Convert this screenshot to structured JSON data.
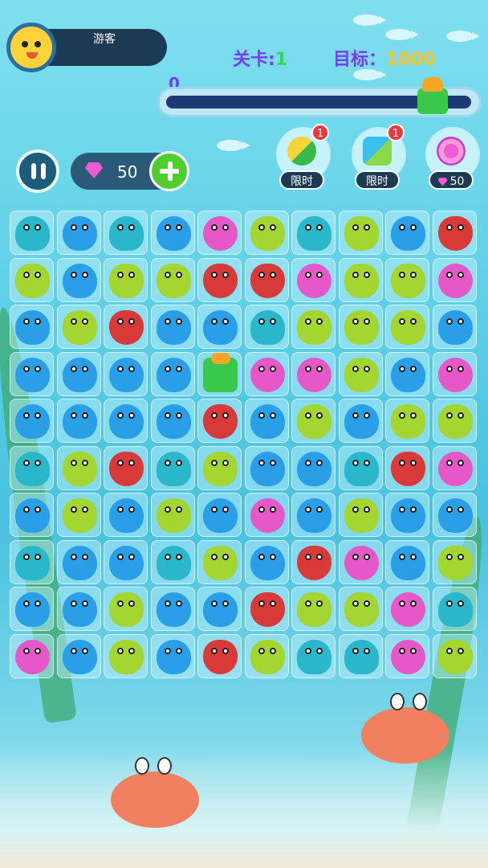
{
  "player": {
    "name": "游客"
  },
  "level": {
    "label": "关卡",
    "value": "1"
  },
  "target": {
    "label": "目标",
    "value": "1000"
  },
  "progress": {
    "score": "0",
    "fraction": 0
  },
  "gems": {
    "count": "50"
  },
  "tools": [
    {
      "name": "限时",
      "badge": "1",
      "icon": "refresh-hammer-icon"
    },
    {
      "name": "限时",
      "badge": "1",
      "icon": "water-gun-icon"
    },
    {
      "name": "50",
      "icon": "lollipop-icon"
    }
  ],
  "board": {
    "rows": [
      [
        "penguin",
        "whale",
        "penguin",
        "whale",
        "puffer",
        "frog",
        "penguin",
        "frog",
        "whale",
        "crab"
      ],
      [
        "frog",
        "whale",
        "frog",
        "frog",
        "crab",
        "crab",
        "puffer",
        "frog",
        "frog",
        "puffer"
      ],
      [
        "whale",
        "frog",
        "crab",
        "whale",
        "whale",
        "penguin",
        "frog",
        "frog",
        "frog",
        "whale"
      ],
      [
        "whale",
        "whale",
        "whale",
        "whale",
        "gift",
        "puffer",
        "puffer",
        "frog",
        "whale",
        "puffer"
      ],
      [
        "whale",
        "whale",
        "whale",
        "whale",
        "crab",
        "whale",
        "frog",
        "whale",
        "frog",
        "frog"
      ],
      [
        "penguin",
        "frog",
        "crab",
        "penguin",
        "frog",
        "whale",
        "whale",
        "penguin",
        "crab",
        "puffer"
      ],
      [
        "whale",
        "frog",
        "whale",
        "frog",
        "whale",
        "puffer",
        "whale",
        "frog",
        "whale",
        "whale"
      ],
      [
        "penguin",
        "whale",
        "whale",
        "penguin",
        "frog",
        "whale",
        "crab",
        "puffer",
        "whale",
        "frog"
      ],
      [
        "whale",
        "whale",
        "frog",
        "whale",
        "whale",
        "crab",
        "frog",
        "frog",
        "puffer",
        "penguin"
      ],
      [
        "puffer",
        "whale",
        "frog",
        "whale",
        "crab",
        "frog",
        "penguin",
        "penguin",
        "puffer",
        "frog"
      ]
    ]
  },
  "colors": {
    "whale": "#2a9fe8",
    "penguin": "#29b7c9",
    "frog": "#a4d632",
    "crab": "#d83a3a",
    "puffer": "#e657c8",
    "gift": "#39c84a",
    "accent_purple": "#7a3cf0",
    "level_green": "#37d64d",
    "target_yellow": "#f3c52a"
  }
}
